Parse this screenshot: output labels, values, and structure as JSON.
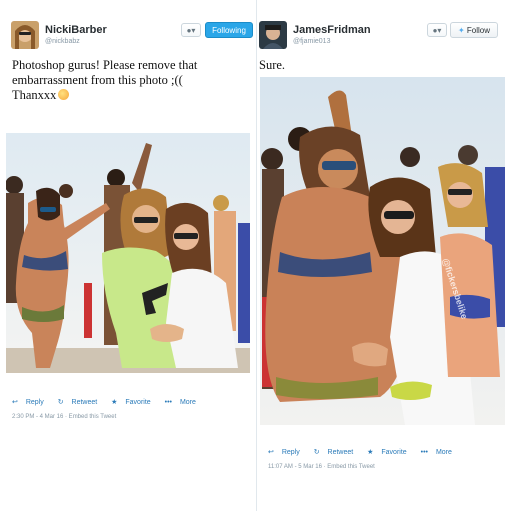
{
  "left_tweet": {
    "display_name": "NickiBarber",
    "handle": "@nickbabz",
    "gear_label": "▾",
    "follow_button_label": "Following",
    "text_line1": "Photoshop gurus! Please remove that",
    "text_line2": "embarrassment from this photo ;((",
    "text_line3": "Thanxxx",
    "actions": {
      "reply": "Reply",
      "retweet": "Retweet",
      "favorite": "Favorite",
      "more": "More"
    },
    "timestamp": "2:30 PM - 4 Mar 16 · Embed this Tweet"
  },
  "right_tweet": {
    "display_name": "JamesFridman",
    "handle": "@fjamie013",
    "gear_label": "▾",
    "follow_button_label": "Follow",
    "text": "Sure.",
    "watermark": "@fickersbelike",
    "actions": {
      "reply": "Reply",
      "retweet": "Retweet",
      "favorite": "Favorite",
      "more": "More"
    },
    "timestamp": "11:07 AM - 5 Mar 16 · Embed this Tweet"
  }
}
